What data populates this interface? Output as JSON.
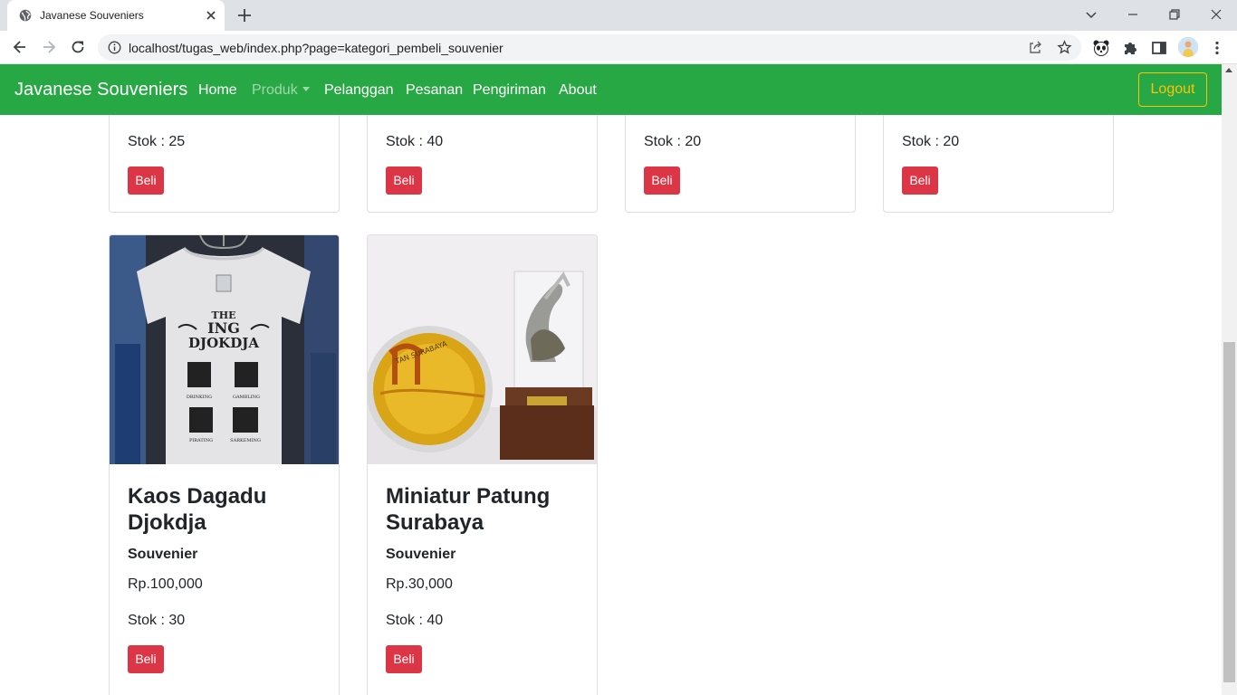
{
  "browser": {
    "tab_title": "Javanese Souveniers",
    "url": "localhost/tugas_web/index.php?page=kategori_pembeli_souvenier"
  },
  "nav": {
    "brand": "Javanese Souveniers",
    "links": [
      "Home",
      "Produk",
      "Pelanggan",
      "Pesanan",
      "Pengiriman",
      "About"
    ],
    "logout": "Logout",
    "colors": {
      "navbar": "#28a745",
      "logout": "#ffc107",
      "buy": "#dc3545"
    }
  },
  "products_row1": [
    {
      "stock": "Stok : 25",
      "buy_label": "Beli"
    },
    {
      "stock": "Stok : 40",
      "buy_label": "Beli"
    },
    {
      "stock": "Stok : 20",
      "buy_label": "Beli"
    },
    {
      "stock": "Stok : 20",
      "buy_label": "Beli"
    }
  ],
  "products_row2": [
    {
      "name": "Kaos Dagadu Djokdja",
      "category": "Souvenier",
      "price": "Rp.100,000",
      "stock": "Stok : 30",
      "buy_label": "Beli",
      "image_text": "THE ING DJOKDJA",
      "image_captions": [
        "DRINKING",
        "GAMBLING",
        "PIRATING",
        "SARKEMING"
      ]
    },
    {
      "name": "Miniatur Patung Surabaya",
      "category": "Souvenier",
      "price": "Rp.30,000",
      "stock": "Stok : 40",
      "buy_label": "Beli",
      "image_text": "TAN SURABAYA"
    }
  ]
}
